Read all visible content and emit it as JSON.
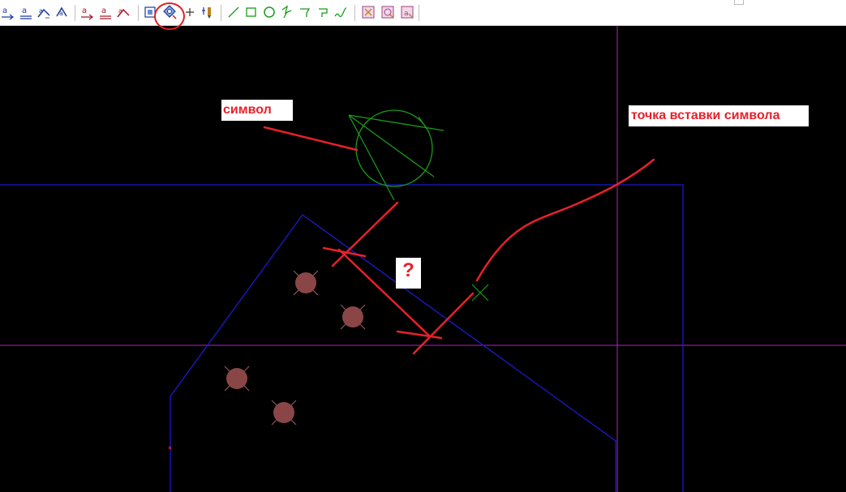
{
  "toolbar": {
    "tools": [
      {
        "name": "text-place-icon"
      },
      {
        "name": "text-edit-icon"
      },
      {
        "name": "text-rotate-icon"
      },
      {
        "name": "text-mirror-icon"
      },
      {
        "name": "attribute-place-icon"
      },
      {
        "name": "attribute-edit-icon"
      },
      {
        "name": "attribute-rotate-icon"
      },
      {
        "name": "select-window-icon"
      },
      {
        "name": "symbol-insert-icon",
        "highlighted": true
      },
      {
        "name": "point-add-icon"
      },
      {
        "name": "marker-icon"
      },
      {
        "name": "line-icon"
      },
      {
        "name": "rectangle-icon"
      },
      {
        "name": "circle-icon"
      },
      {
        "name": "polyline-icon"
      },
      {
        "name": "step-line-icon"
      },
      {
        "name": "step-corner-icon"
      },
      {
        "name": "wave-line-icon"
      },
      {
        "name": "cancel-window-icon"
      },
      {
        "name": "cancel-symbol-icon"
      },
      {
        "name": "cancel-text-icon"
      }
    ]
  },
  "annotations": {
    "symbol": "символ",
    "insertion_point": "точка вставки символа",
    "question": "?"
  },
  "colors": {
    "background": "#000000",
    "crosshair": "#b020c0",
    "outline": "#1a1ad0",
    "symbol": "#1a9a1a",
    "annotation": "#e8202a",
    "pad_fill": "#8a4646"
  }
}
